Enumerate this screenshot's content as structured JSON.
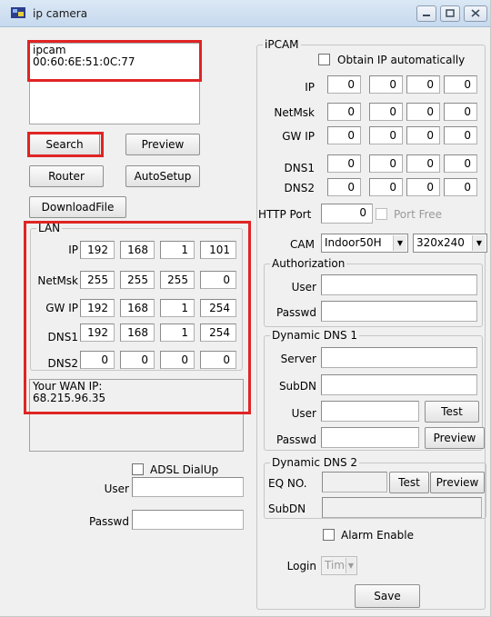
{
  "window": {
    "title": "ip camera"
  },
  "device_list": [
    "ipcam",
    "00:60:6E:51:0C:77"
  ],
  "buttons": {
    "search": "Search",
    "preview": "Preview",
    "router": "Router",
    "autosetup": "AutoSetup",
    "downloadfile": "DownloadFile"
  },
  "lan": {
    "legend": "LAN",
    "rows": [
      {
        "label": "IP",
        "octets": [
          "192",
          "168",
          "1",
          "101"
        ]
      },
      {
        "label": "NetMsk",
        "octets": [
          "255",
          "255",
          "255",
          "0"
        ]
      },
      {
        "label": "GW IP",
        "octets": [
          "192",
          "168",
          "1",
          "254"
        ]
      },
      {
        "label": "DNS1",
        "octets": [
          "192",
          "168",
          "1",
          "254"
        ]
      },
      {
        "label": "DNS2",
        "octets": [
          "0",
          "0",
          "0",
          "0"
        ]
      }
    ]
  },
  "wan": {
    "line1": "Your WAN IP:",
    "line2": "68.215.96.35"
  },
  "adsl": {
    "checkbox_label": "ADSL DialUp",
    "user_label": "User",
    "passwd_label": "Passwd",
    "user_value": "",
    "passwd_value": ""
  },
  "ipcam": {
    "legend": "iPCAM",
    "obtain_ip_label": "Obtain IP automatically",
    "rows": [
      {
        "label": "IP",
        "octets": [
          "0",
          "0",
          "0",
          "0"
        ]
      },
      {
        "label": "NetMsk",
        "octets": [
          "0",
          "0",
          "0",
          "0"
        ]
      },
      {
        "label": "GW IP",
        "octets": [
          "0",
          "0",
          "0",
          "0"
        ]
      },
      {
        "label": "DNS1",
        "octets": [
          "0",
          "0",
          "0",
          "0"
        ]
      },
      {
        "label": "DNS2",
        "octets": [
          "0",
          "0",
          "0",
          "0"
        ]
      }
    ],
    "http_port_label": "HTTP Port",
    "http_port_value": "0",
    "port_free_label": "Port Free",
    "cam_label": "CAM",
    "cam_model": "Indoor50H",
    "cam_resolution": "320x240"
  },
  "authorization": {
    "legend": "Authorization",
    "user_label": "User",
    "passwd_label": "Passwd"
  },
  "ddns1": {
    "legend": "Dynamic DNS 1",
    "server_label": "Server",
    "subdn_label": "SubDN",
    "user_label": "User",
    "passwd_label": "Passwd",
    "test": "Test",
    "preview": "Preview"
  },
  "ddns2": {
    "legend": "Dynamic DNS 2",
    "eqno_label": "EQ NO.",
    "test": "Test",
    "preview": "Preview",
    "subdn_label": "SubDN"
  },
  "alarm": {
    "label": "Alarm Enable",
    "login_label": "Login",
    "login_value": "Time"
  },
  "save": "Save",
  "colors": {
    "highlight": "#e02424",
    "titlebar": "#c6d9ee"
  }
}
